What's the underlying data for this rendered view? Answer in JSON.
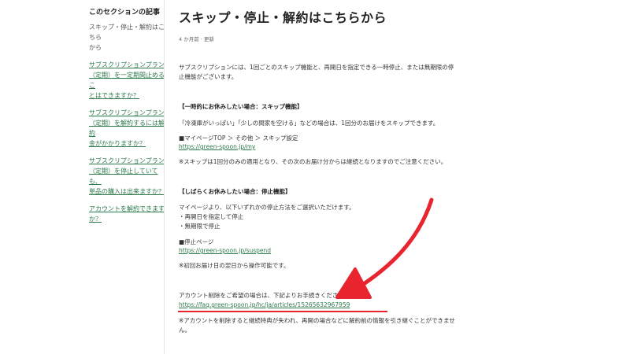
{
  "sidebar": {
    "section_title": "このセクションの記事",
    "items": [
      {
        "label_lines": [
          "スキップ・停止・解約はこちら",
          "から"
        ],
        "current": true
      },
      {
        "label_lines": [
          "サブスクリプションプラン",
          "（定期）を一定期間止めるこ",
          "とはできますか？"
        ]
      },
      {
        "label_lines": [
          "サブスクリプションプラン",
          "（定期）を解約するには解約",
          "金がかかりますか？"
        ]
      },
      {
        "label_lines": [
          "サブスクリプションプラン",
          "（定期）を停止していても、",
          "単品の購入は出来ますか？"
        ]
      },
      {
        "label_lines": [
          "アカウントを解約できます",
          "か？"
        ]
      }
    ]
  },
  "article": {
    "title": "スキップ・停止・解約はこちらから",
    "meta": "4 か月前 · 更新",
    "intro_lines": [
      "サブスクリプションには、1回ごとのスキップ機能と、再開日を指定できる一時停止、または無期限の停",
      "止機能がございます。"
    ],
    "skip": {
      "heading": "【一時的にお休みしたい場合：スキップ機能】",
      "desc": "「冷凍庫がいっぱい」「少しの間家を空ける」などの場合は、1回分のお届けをスキップできます。",
      "path": "■マイページTOP ＞ その他 ＞ スキップ設定",
      "link": "https://green-spoon.jp/my",
      "note": "※スキップは1回分のみの適用となり、その次のお届け分からは継続となりますのでご注意ください。"
    },
    "stop": {
      "heading": "【しばらくお休みしたい場合：停止機能】",
      "desc": "マイページより、以下いずれかの停止方法をご選択いただけます。",
      "options": [
        "・再開日を指定して停止",
        "・無期限で停止"
      ],
      "page_label": "■停止ページ",
      "link": "https://green-spoon.jp/suspend",
      "note": "※初回お届け日の翌日から操作可能です。"
    },
    "account": {
      "desc": "アカウント削除をご希望の場合は、下記よりお手続きください。",
      "link": "https://faq.green-spoon.jp/hc/ja/articles/15265632967959",
      "note_lines": [
        "※アカウントを削除すると継続特典が失われ、再開の場合などに解約前の情報を引き継ぐことができませ",
        "ん。"
      ]
    }
  },
  "annotation": {
    "arrow_color": "#e8242f",
    "underline_color": "#e8242f"
  }
}
